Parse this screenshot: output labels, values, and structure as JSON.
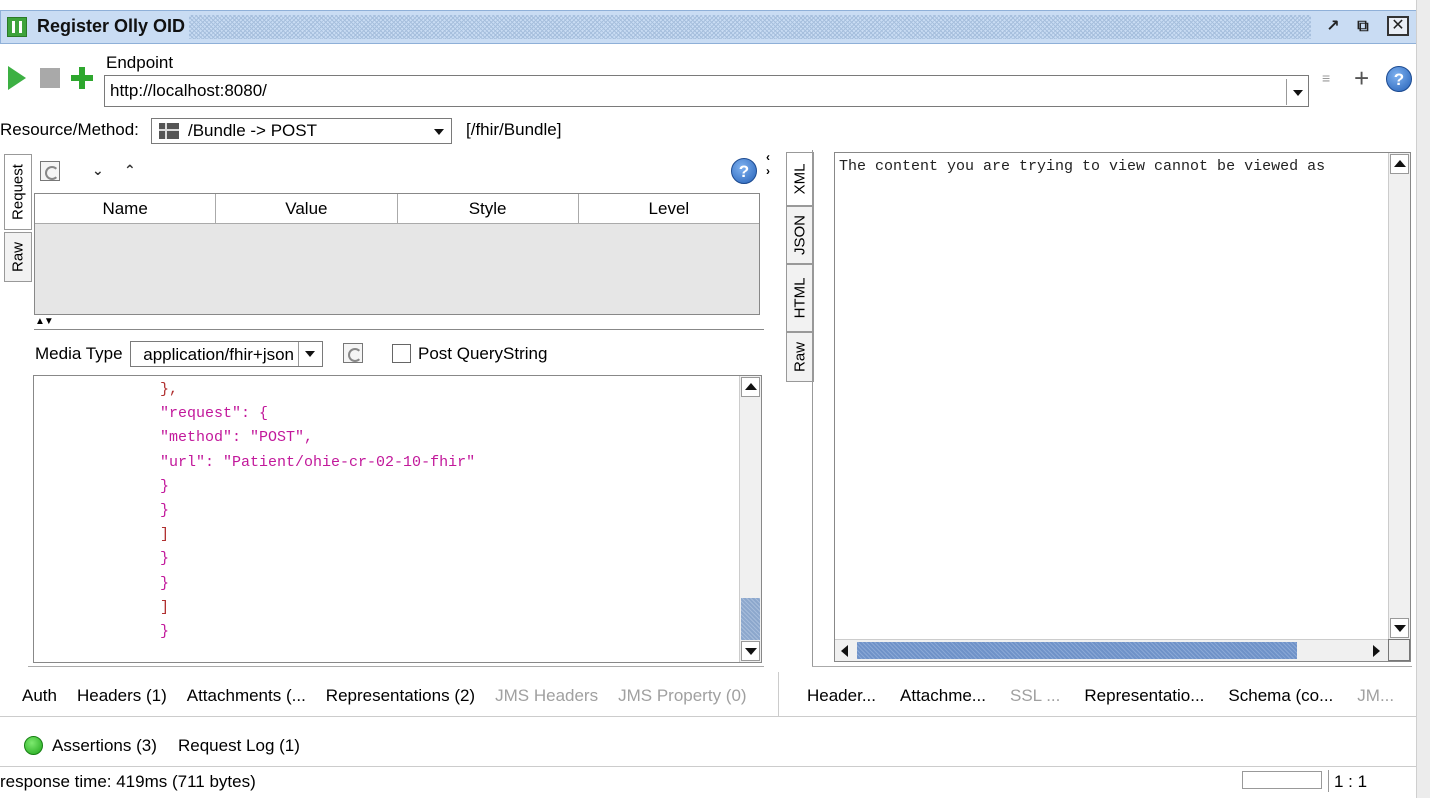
{
  "window": {
    "title": "Register Olly OID"
  },
  "toolbar": {
    "endpoint_label": "Endpoint",
    "endpoint_value": "http://localhost:8080/"
  },
  "resource": {
    "label": "Resource/Method:",
    "value": "/Bundle -> POST",
    "path": "[/fhir/Bundle]"
  },
  "request": {
    "tabs": [
      "Request",
      "Raw"
    ],
    "params_columns": [
      "Name",
      "Value",
      "Style",
      "Level"
    ],
    "media_type_label": "Media Type",
    "media_type_value": "application/fhir+json",
    "post_querystring_label": "Post QueryString",
    "post_querystring_checked": false,
    "body_lines": [
      "              },",
      "              \"request\": {",
      "              \"method\": \"POST\",",
      "              \"url\": \"Patient/ohie-cr-02-10-fhir\"",
      "              }",
      "              }",
      "              ]",
      "              }",
      "              }",
      "              ]",
      "              }"
    ],
    "bottom_tabs": [
      {
        "label": "Auth",
        "enabled": true
      },
      {
        "label": "Headers (1)",
        "enabled": true
      },
      {
        "label": "Attachments (...",
        "enabled": true
      },
      {
        "label": "Representations (2)",
        "enabled": true
      },
      {
        "label": "JMS Headers",
        "enabled": false
      },
      {
        "label": "JMS Property (0)",
        "enabled": false
      }
    ]
  },
  "response": {
    "tabs": [
      "XML",
      "JSON",
      "HTML",
      "Raw"
    ],
    "content_text": "The content you are trying to view cannot be viewed as",
    "bottom_tabs": [
      {
        "label": "Header...",
        "enabled": true
      },
      {
        "label": "Attachme...",
        "enabled": true
      },
      {
        "label": "SSL ...",
        "enabled": false
      },
      {
        "label": "Representatio...",
        "enabled": true
      },
      {
        "label": "Schema (co...",
        "enabled": true
      },
      {
        "label": "JM...",
        "enabled": false
      }
    ]
  },
  "footer": {
    "assertions_label": "Assertions (3)",
    "assertions_status_color": "#22b01c",
    "request_log_label": "Request Log (1)",
    "response_time": "response time: 419ms (711 bytes)",
    "zoom": "1 : 1"
  },
  "colors": {
    "titlebar_bg": "#c9dcf3",
    "json_punct": "#b03030",
    "json_key": "#c2189b",
    "disabled_text": "#a0a0a0"
  }
}
